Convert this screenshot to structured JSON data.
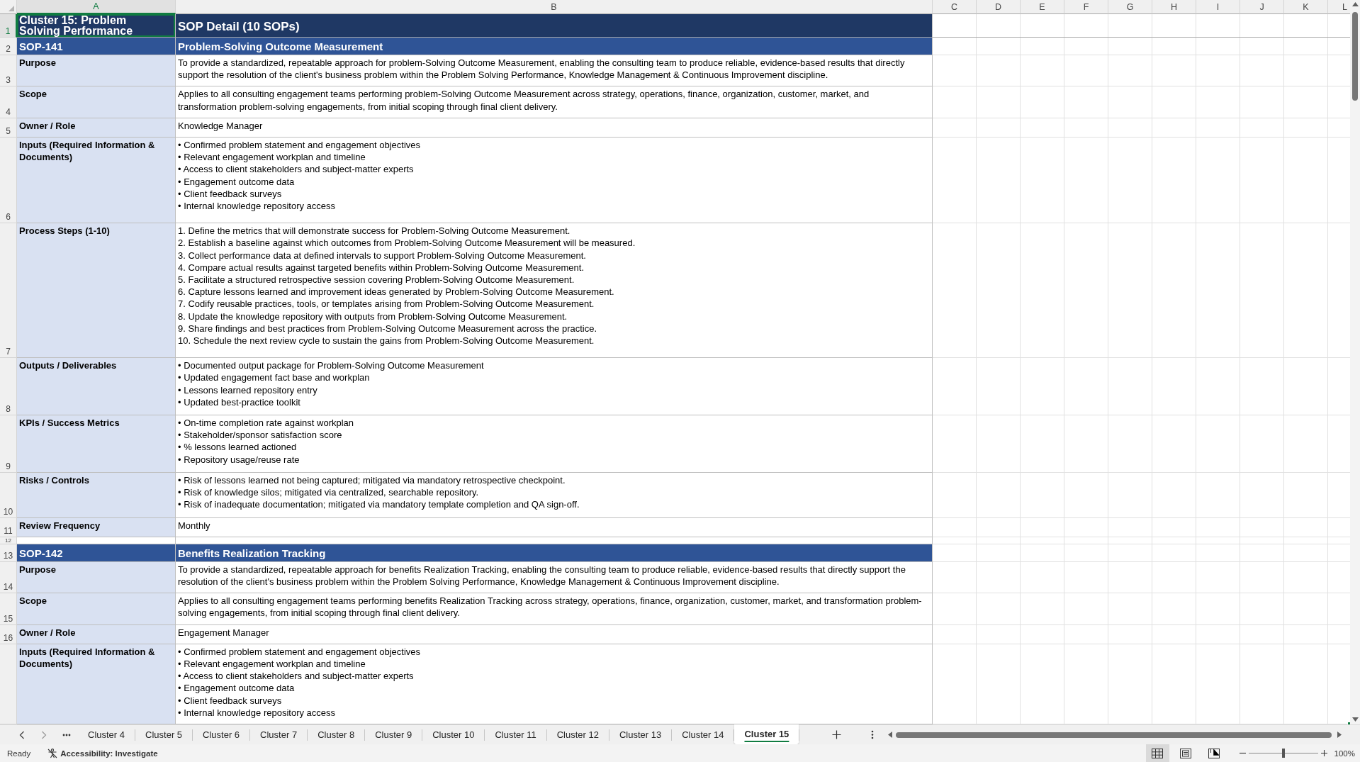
{
  "column_headers": [
    {
      "label": "A",
      "selected": true
    },
    {
      "label": "B",
      "selected": false
    },
    {
      "label": "C",
      "selected": false
    },
    {
      "label": "D",
      "selected": false
    },
    {
      "label": "E",
      "selected": false
    },
    {
      "label": "F",
      "selected": false
    },
    {
      "label": "G",
      "selected": false
    },
    {
      "label": "H",
      "selected": false
    },
    {
      "label": "I",
      "selected": false
    },
    {
      "label": "J",
      "selected": false
    },
    {
      "label": "K",
      "selected": false
    },
    {
      "label": "L",
      "selected": false
    }
  ],
  "rows": [
    {
      "kind": "title",
      "row_number": "1",
      "selected": true,
      "cluster": "Cluster 15: Problem Solving Performance",
      "title": "SOP Detail (10 SOPs)"
    },
    {
      "kind": "sop_header",
      "row_number": "2",
      "selected": false,
      "sop_id": "SOP-141",
      "sop_title": "Problem-Solving Outcome Measurement"
    },
    {
      "kind": "text",
      "row_number": "3",
      "selected": false,
      "label": "Purpose",
      "text": "To provide a standardized, repeatable approach for problem-Solving Outcome Measurement, enabling the consulting team to produce reliable, evidence-based results that directly support the resolution of the client's business problem within the Problem Solving Performance, Knowledge Management & Continuous Improvement discipline."
    },
    {
      "kind": "text",
      "row_number": "4",
      "selected": false,
      "label": "Scope",
      "text": "Applies to all consulting engagement teams performing problem-Solving Outcome Measurement across strategy, operations, finance, organization, customer, market, and transformation problem-solving engagements, from initial scoping through final client delivery."
    },
    {
      "kind": "text",
      "row_number": "5",
      "selected": false,
      "label": "Owner / Role",
      "text": "Knowledge Manager"
    },
    {
      "kind": "list",
      "row_number": "6",
      "selected": false,
      "label": "Inputs (Required Information & Documents)",
      "lines": [
        "• Confirmed problem statement and engagement objectives",
        "• Relevant engagement workplan and timeline",
        "• Access to client stakeholders and subject-matter experts",
        "• Engagement outcome data",
        "• Client feedback surveys",
        "• Internal knowledge repository access"
      ]
    },
    {
      "kind": "list",
      "row_number": "7",
      "selected": false,
      "label": "Process Steps (1-10)",
      "lines": [
        "1. Define the metrics that will demonstrate success for Problem-Solving Outcome Measurement.",
        "2. Establish a baseline against which outcomes from Problem-Solving Outcome Measurement will be measured.",
        "3. Collect performance data at defined intervals to support Problem-Solving Outcome Measurement.",
        "4. Compare actual results against targeted benefits within Problem-Solving Outcome Measurement.",
        "5. Facilitate a structured retrospective session covering Problem-Solving Outcome Measurement.",
        "6. Capture lessons learned and improvement ideas generated by Problem-Solving Outcome Measurement.",
        "7. Codify reusable practices, tools, or templates arising from Problem-Solving Outcome Measurement.",
        "8. Update the knowledge repository with outputs from Problem-Solving Outcome Measurement.",
        "9. Share findings and best practices from Problem-Solving Outcome Measurement across the practice.",
        "10. Schedule the next review cycle to sustain the gains from Problem-Solving Outcome Measurement."
      ]
    },
    {
      "kind": "list",
      "row_number": "8",
      "selected": false,
      "label": "Outputs / Deliverables",
      "lines": [
        "• Documented output package for Problem-Solving Outcome Measurement",
        "• Updated engagement fact base and workplan",
        "• Lessons learned repository entry",
        "• Updated best-practice toolkit"
      ]
    },
    {
      "kind": "list",
      "row_number": "9",
      "selected": false,
      "label": "KPIs / Success Metrics",
      "lines": [
        "• On-time completion rate against workplan",
        "• Stakeholder/sponsor satisfaction score",
        "• % lessons learned actioned",
        "• Repository usage/reuse rate"
      ]
    },
    {
      "kind": "list",
      "row_number": "10",
      "selected": false,
      "label": "Risks / Controls",
      "lines": [
        "• Risk of lessons learned not being captured; mitigated via mandatory retrospective checkpoint.",
        "• Risk of knowledge silos; mitigated via centralized, searchable repository.",
        "• Risk of inadequate documentation; mitigated via mandatory template completion and QA sign-off."
      ]
    },
    {
      "kind": "text",
      "row_number": "11",
      "selected": false,
      "label": "Review Frequency",
      "text": "Monthly"
    },
    {
      "kind": "spacer",
      "row_number": "12",
      "selected": false
    },
    {
      "kind": "sop_header",
      "row_number": "13",
      "selected": false,
      "sop_id": "SOP-142",
      "sop_title": "Benefits Realization Tracking"
    },
    {
      "kind": "text",
      "row_number": "14",
      "selected": false,
      "label": "Purpose",
      "text": "To provide a standardized, repeatable approach for benefits Realization Tracking, enabling the consulting team to produce reliable, evidence-based results that directly support the resolution of the client's business problem within the Problem Solving Performance, Knowledge Management & Continuous Improvement discipline."
    },
    {
      "kind": "text",
      "row_number": "15",
      "selected": false,
      "label": "Scope",
      "text": "Applies to all consulting engagement teams performing benefits Realization Tracking across strategy, operations, finance, organization, customer, market, and transformation problem-solving engagements, from initial scoping through final client delivery."
    },
    {
      "kind": "text",
      "row_number": "16",
      "selected": false,
      "label": "Owner / Role",
      "text": "Engagement Manager"
    },
    {
      "kind": "list",
      "selected": false,
      "label": "Inputs (Required Information & Documents)",
      "lines": [
        "• Confirmed problem statement and engagement objectives",
        "• Relevant engagement workplan and timeline",
        "• Access to client stakeholders and subject-matter experts",
        "• Engagement outcome data",
        "• Client feedback surveys",
        "• Internal knowledge repository access"
      ]
    }
  ],
  "sheet_tabs": [
    {
      "label": "Cluster 4",
      "selected": false
    },
    {
      "label": "Cluster 5",
      "selected": false
    },
    {
      "label": "Cluster 6",
      "selected": false
    },
    {
      "label": "Cluster 7",
      "selected": false
    },
    {
      "label": "Cluster 8",
      "selected": false
    },
    {
      "label": "Cluster 9",
      "selected": false
    },
    {
      "label": "Cluster 10",
      "selected": false
    },
    {
      "label": "Cluster 11",
      "selected": false
    },
    {
      "label": "Cluster 12",
      "selected": false
    },
    {
      "label": "Cluster 13",
      "selected": false
    },
    {
      "label": "Cluster 14",
      "selected": false
    },
    {
      "label": "Cluster 15",
      "selected": true
    }
  ],
  "status_bar": {
    "status": "Ready",
    "accessibility": "Accessibility: Investigate",
    "views": [
      {
        "kind": "normal",
        "selected": true
      },
      {
        "kind": "page_layout",
        "selected": false
      },
      {
        "kind": "page_break_preview",
        "selected": false
      }
    ],
    "zoom": {
      "level": 0.5,
      "reading": "100%"
    }
  }
}
